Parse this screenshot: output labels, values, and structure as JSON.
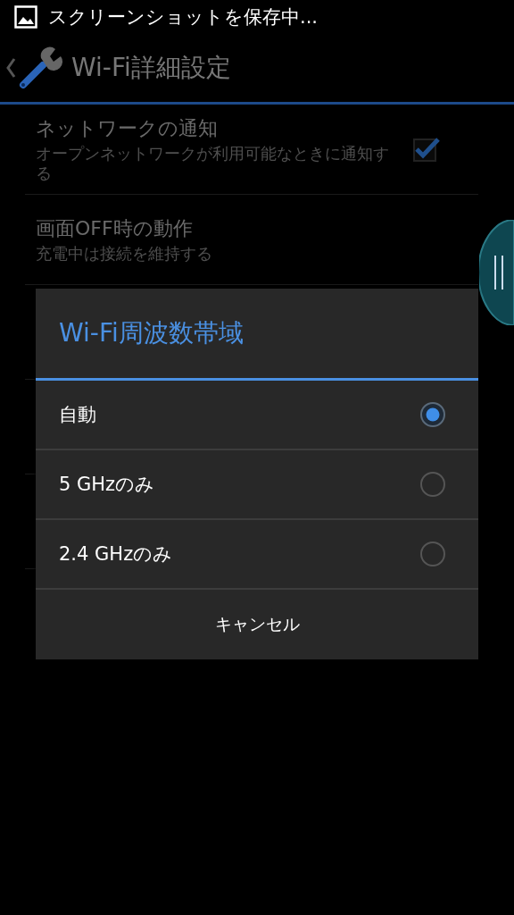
{
  "status_bar": {
    "notification": "スクリーンショットを保存中..."
  },
  "action_bar": {
    "title": "Wi-Fi詳細設定"
  },
  "preferences": [
    {
      "kind": "checkbox",
      "title": "ネットワークの通知",
      "summary": "オープンネットワークが利用可能なときに通知する",
      "checked": true
    },
    {
      "kind": "plain",
      "title": "画面OFF時の動作",
      "summary": "充電中は接続を維持する"
    }
  ],
  "dialog": {
    "title": "Wi-Fi周波数帯域",
    "options": [
      {
        "label": "自動",
        "selected": true
      },
      {
        "label": "5 GHzのみ",
        "selected": false
      },
      {
        "label": "2.4 GHzのみ",
        "selected": false
      }
    ],
    "cancel": "キャンセル"
  }
}
